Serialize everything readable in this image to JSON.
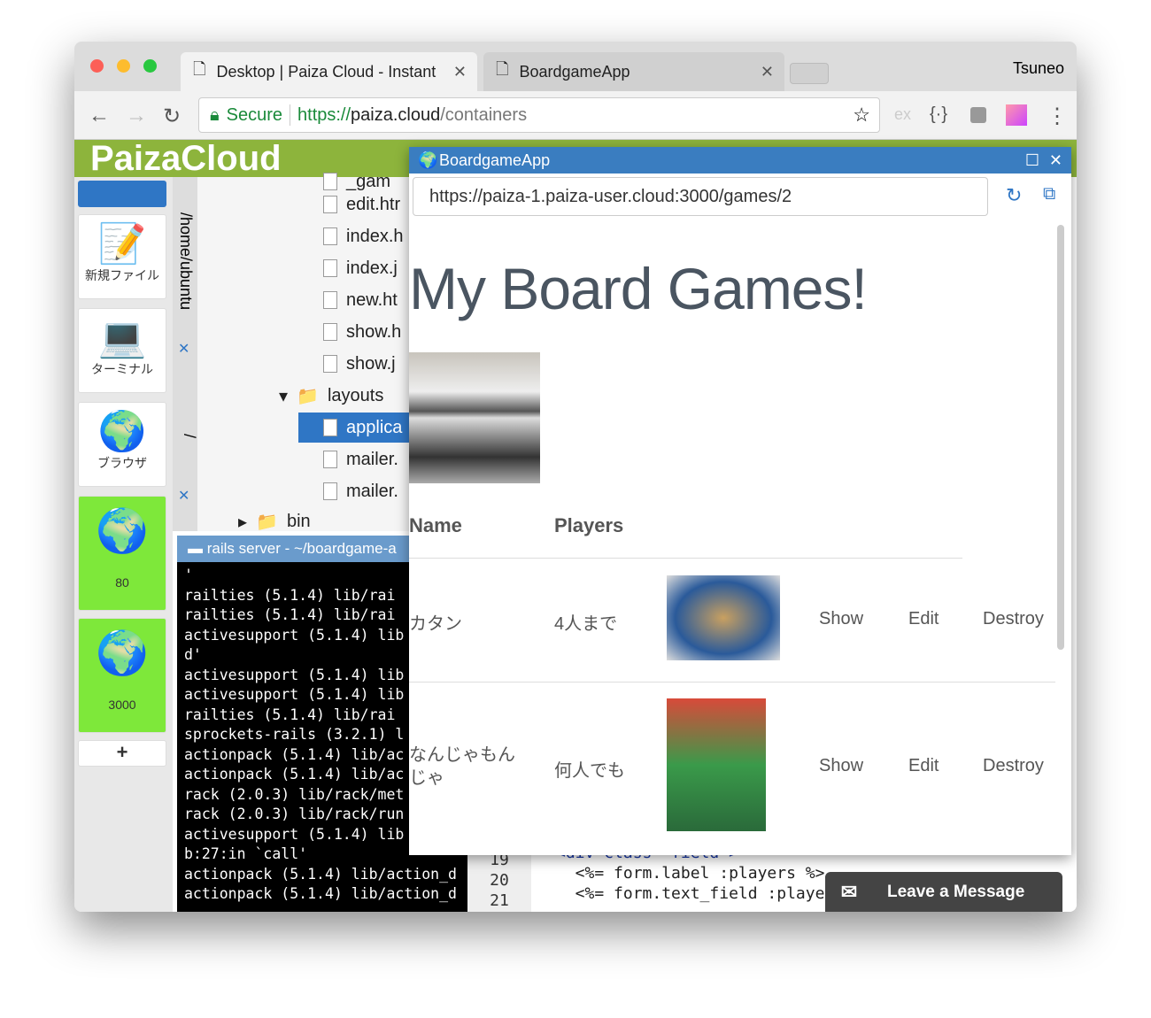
{
  "browser": {
    "tabs": [
      {
        "title": "Desktop | Paiza Cloud - Instant"
      },
      {
        "title": "BoardgameApp"
      }
    ],
    "profile": "Tsuneo",
    "secure_label": "Secure",
    "url_scheme": "https://",
    "url_host": "paiza.cloud",
    "url_path": "/containers",
    "ext_label": "ex",
    "ext2_label": "{·}"
  },
  "app": {
    "logo": "PaizaCloud"
  },
  "sidebar": {
    "items": [
      {
        "label": "新規ファイル"
      },
      {
        "label": "ターミナル"
      },
      {
        "label": "ブラウザ"
      },
      {
        "label": "80"
      },
      {
        "label": "3000"
      }
    ],
    "add": "+"
  },
  "tree": {
    "path1": "/home/ubuntu",
    "path2": "/",
    "files": [
      "_gam",
      "edit.htr",
      "index.h",
      "index.j",
      "new.ht",
      "show.h",
      "show.j",
      "layouts",
      "applica",
      "mailer.",
      "mailer.",
      "bin"
    ]
  },
  "terminal": {
    "title": "rails server - ~/boardgame-a",
    "lines": [
      "'",
      "railties (5.1.4) lib/rai",
      "railties (5.1.4) lib/rai",
      "activesupport (5.1.4) lib",
      "d'",
      "activesupport (5.1.4) lib",
      "activesupport (5.1.4) lib",
      "railties (5.1.4) lib/rai",
      "sprockets-rails (3.2.1) l",
      "actionpack (5.1.4) lib/ac",
      "actionpack (5.1.4) lib/ac",
      "rack (2.0.3) lib/rack/met",
      "rack (2.0.3) lib/rack/run",
      "activesupport (5.1.4) lib",
      "b:27:in `call'",
      "actionpack (5.1.4) lib/action_d",
      "actionpack (5.1.4) lib/action_d"
    ]
  },
  "editor": {
    "lines": [
      {
        "n": "19",
        "code": "<div class=\"field\">"
      },
      {
        "n": "20",
        "code": "  <%= form.label :players %>"
      },
      {
        "n": "21",
        "code": "  <%= form.text_field :playe"
      }
    ]
  },
  "popup": {
    "title": "BoardgameApp",
    "url": "https://paiza-1.paiza-user.cloud:3000/games/2",
    "heading": "My Board Games!",
    "columns": [
      "Name",
      "Players"
    ],
    "rows": [
      {
        "name": "カタン",
        "players": "4人まで"
      },
      {
        "name": "なんじゃもんじゃ",
        "players": "何人でも"
      }
    ],
    "actions": [
      "Show",
      "Edit",
      "Destroy"
    ]
  },
  "chat": {
    "label": "Leave a Message"
  }
}
